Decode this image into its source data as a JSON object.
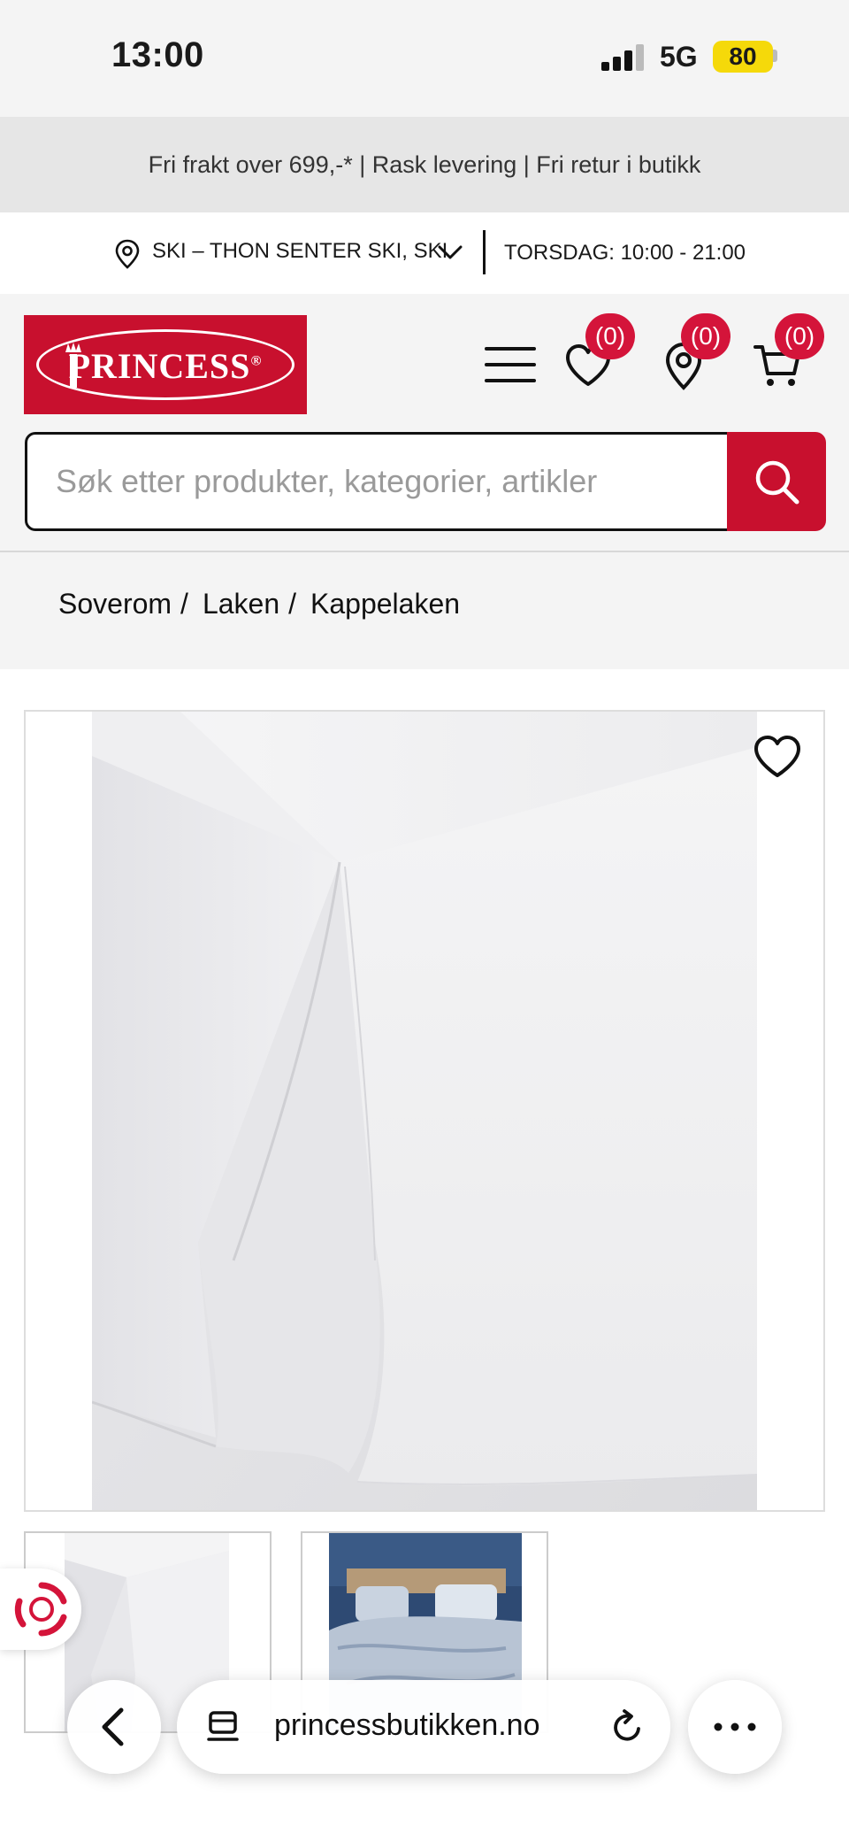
{
  "status_bar": {
    "time": "13:00",
    "network": "5G",
    "battery": "80"
  },
  "promo_banner": {
    "text": "Fri frakt over 699,-* | Rask levering | Fri retur i butikk"
  },
  "store": {
    "name": "SKI – THON SENTER SKI, SKI",
    "hours": "TORSDAG: 10:00 - 21:00"
  },
  "header": {
    "logo_text": "PRINCESS",
    "logo_mark": "®",
    "wishlist_count": "(0)",
    "stores_count": "(0)",
    "cart_count": "(0)",
    "icons": [
      "menu-icon",
      "heart-icon",
      "location-pin-icon",
      "cart-icon"
    ]
  },
  "search": {
    "placeholder": "Søk etter produkter, kategorier, artikler"
  },
  "breadcrumb": {
    "items": [
      "Soverom",
      "Laken",
      "Kappelaken"
    ],
    "separator": "/"
  },
  "browser": {
    "url": "princessbutikken.no"
  },
  "colors": {
    "brand_red": "#c8102e",
    "badge_red": "#d4143a",
    "battery_yellow": "#f5d90a"
  }
}
